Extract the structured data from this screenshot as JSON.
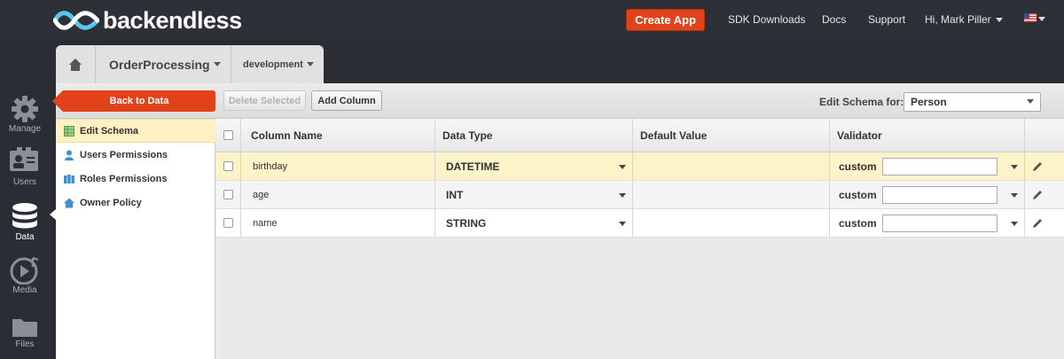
{
  "header": {
    "brand": "backendless",
    "create_app": "Create App",
    "links": [
      "SDK Downloads",
      "Docs",
      "Support"
    ],
    "user_menu": "Hi, Mark Piller"
  },
  "tabs": {
    "app_name": "OrderProcessing",
    "version": "development"
  },
  "leftnav": {
    "items": [
      {
        "label": "Manage",
        "icon": "gear-icon"
      },
      {
        "label": "Users",
        "icon": "users-icon"
      },
      {
        "label": "Data",
        "icon": "database-icon"
      },
      {
        "label": "Media",
        "icon": "media-icon"
      },
      {
        "label": "Files",
        "icon": "folder-icon"
      }
    ]
  },
  "toolbar": {
    "back": "Back to Data",
    "delete_selected": "Delete Selected",
    "add_column": "Add Column",
    "schema_label": "Edit Schema for:",
    "schema_value": "Person"
  },
  "sidemenu": {
    "items": [
      "Edit Schema",
      "Users Permissions",
      "Roles Permissions",
      "Owner Policy"
    ]
  },
  "grid": {
    "columns": [
      "Column Name",
      "Data Type",
      "Default Value",
      "Validator"
    ],
    "rows": [
      {
        "name": "birthday",
        "type": "DATETIME",
        "default": "",
        "validator": "custom"
      },
      {
        "name": "age",
        "type": "INT",
        "default": "",
        "validator": "custom"
      },
      {
        "name": "name",
        "type": "STRING",
        "default": "",
        "validator": "custom"
      }
    ]
  },
  "colors": {
    "accent": "#e2421a",
    "selected_row": "#fdf3c8",
    "topbar": "#2d3036"
  }
}
